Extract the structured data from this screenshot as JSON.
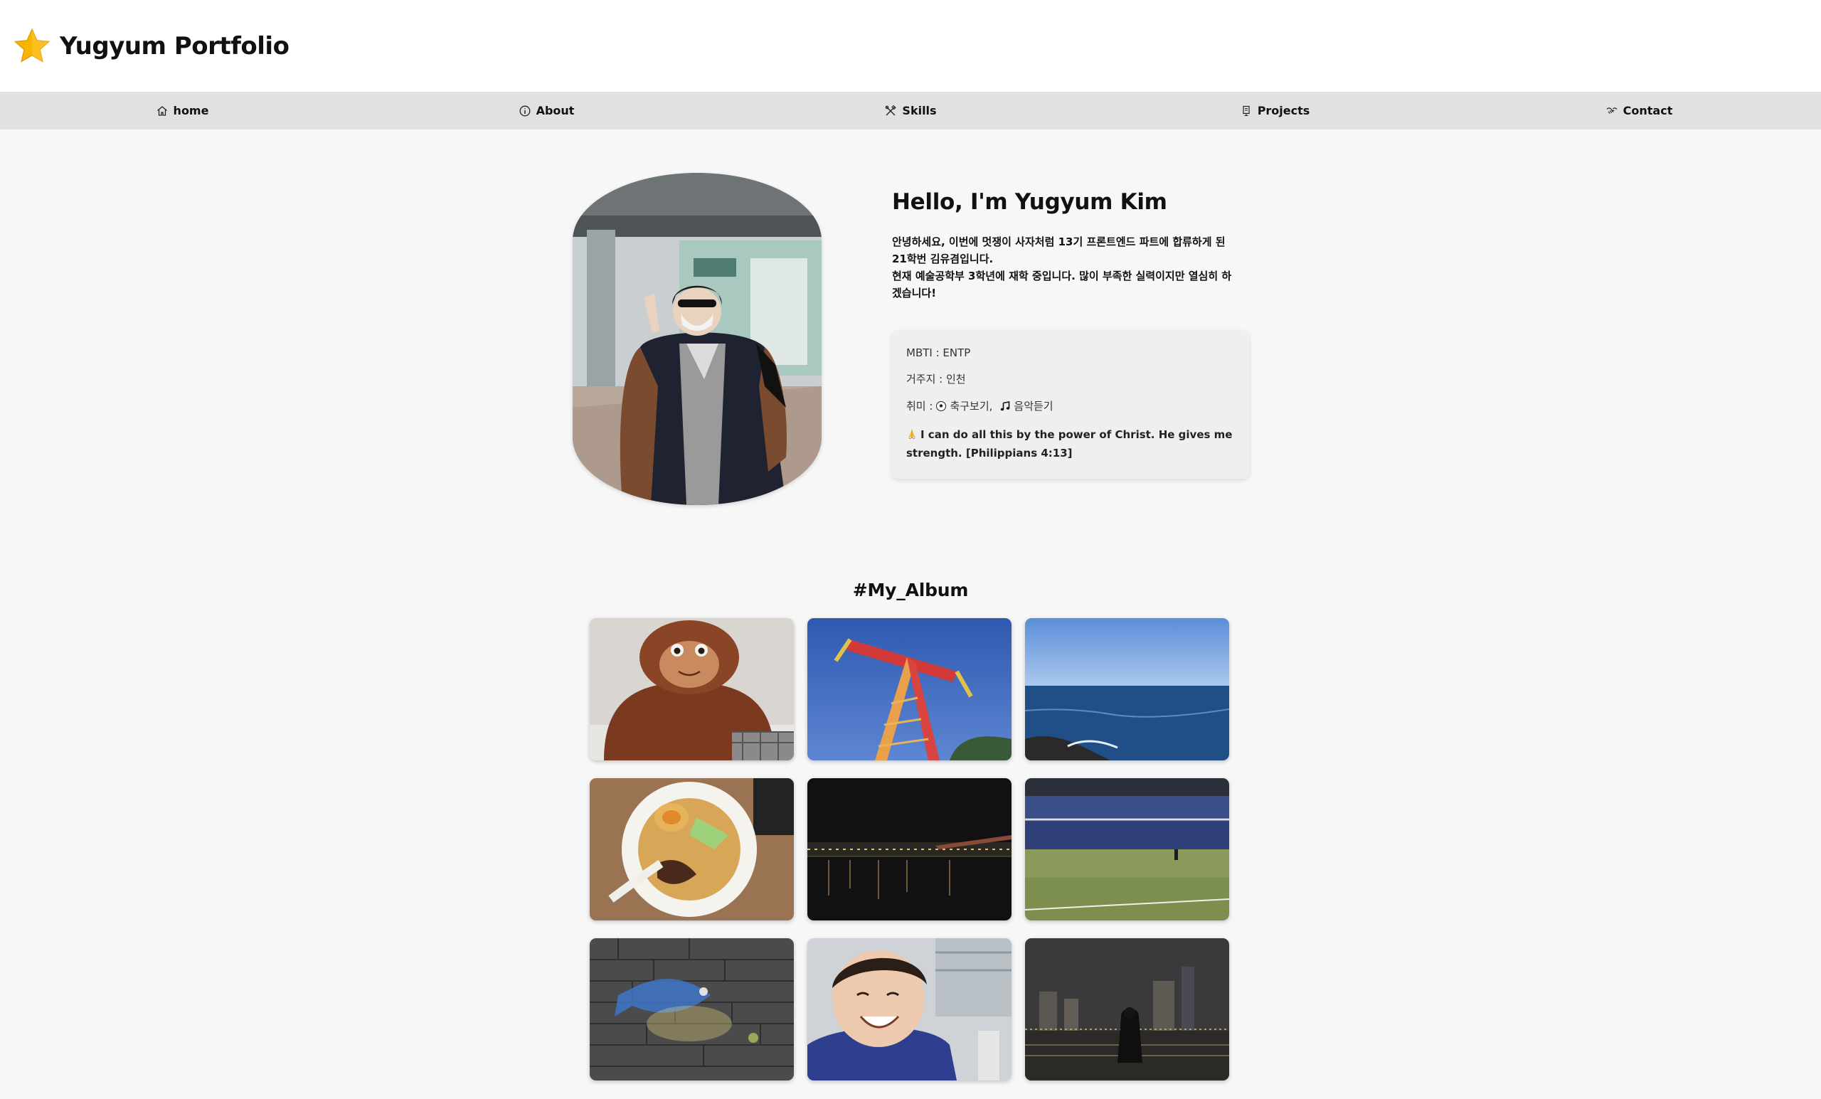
{
  "header": {
    "title": "Yugyum Portfolio",
    "logo_icon": "star-icon",
    "accent_color": "#f7b500"
  },
  "nav": {
    "items": [
      {
        "label": "home",
        "icon": "home-icon"
      },
      {
        "label": "About",
        "icon": "info-icon"
      },
      {
        "label": "Skills",
        "icon": "tools-icon"
      },
      {
        "label": "Projects",
        "icon": "project-icon"
      },
      {
        "label": "Contact",
        "icon": "contact-icon"
      }
    ]
  },
  "intro": {
    "heading": "Hello, I'm Yugyum Kim",
    "lines": [
      "안녕하세요, 이번에 멋쟁이 사자처럼 13기 프론트엔드 파트에 합류하게 된",
      "21학번 김유겸입니다.",
      "현재 예술공학부 3학년에 재학 중입니다. 많이 부족한 실력이지만 열심히 하",
      "겠습니다!"
    ]
  },
  "info": {
    "mbti": "MBTI : ENTP",
    "residence": "거주지 : 인천",
    "hobby_prefix": "취미 : ",
    "hobby_1": "축구보기,",
    "hobby_2": "음악듣기",
    "hobby_icons": [
      "soccer-ball-icon",
      "music-note-icon"
    ],
    "verse": "I can do all this by the power of Christ. He gives me strength. [Philippians 4:13]",
    "verse_icon": "praying-hands-icon"
  },
  "album": {
    "title": "#My_Album",
    "photos": [
      {
        "name": "orangutan-plush-photo"
      },
      {
        "name": "amusement-ride-photo"
      },
      {
        "name": "sea-view-photo"
      },
      {
        "name": "ramen-bowl-photo"
      },
      {
        "name": "river-night-photo"
      },
      {
        "name": "stadium-photo"
      },
      {
        "name": "pavement-chalk-fish-photo"
      },
      {
        "name": "smiling-child-photo"
      },
      {
        "name": "city-night-person-photo"
      }
    ]
  }
}
